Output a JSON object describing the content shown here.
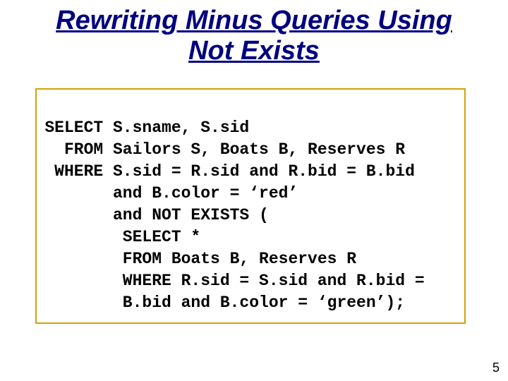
{
  "title_line1": "Rewriting Minus Queries Using",
  "title_line2": "Not Exists",
  "sql": {
    "kw_select": "SELECT",
    "select_body": "S.sname, S.sid",
    "kw_from": "FROM",
    "from_body": "Sailors S, Boats B, Reserves R",
    "kw_where": "WHERE",
    "where_l1": "S.sid = R.sid and R.bid = B.bid",
    "where_l2": "and B.color = ‘red’",
    "where_l3": "and NOT EXISTS (",
    "sub_l1": " SELECT *",
    "sub_l2": " FROM Boats B, Reserves R",
    "sub_l3": " WHERE R.sid = S.sid and R.bid =",
    "sub_l4": " B.bid and B.color = ‘green’);"
  },
  "page_number": "5"
}
